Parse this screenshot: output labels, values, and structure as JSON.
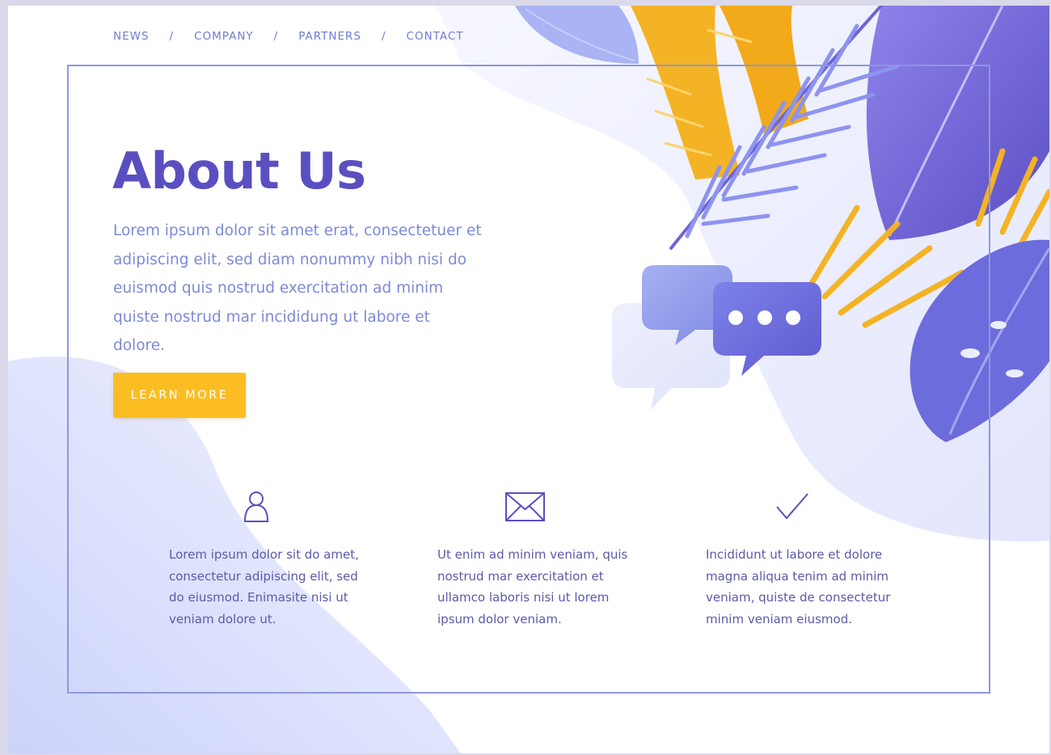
{
  "nav": {
    "items": [
      "NEWS",
      "COMPANY",
      "PARTNERS",
      "CONTACT"
    ],
    "separator": "/"
  },
  "hero": {
    "title": "About Us",
    "description": "Lorem ipsum dolor sit amet erat, consectetuer et adipiscing elit, sed diam nonummy nibh nisi do euismod quis nostrud exercitation ad minim quiste nostrud mar incididung ut labore et dolore.",
    "cta_label": "LEARN MORE"
  },
  "features": [
    {
      "icon": "user-icon",
      "text": "Lorem ipsum dolor sit do amet, consectetur adipiscing elit, sed do eiusmod. Enimasite nisi ut veniam dolore ut."
    },
    {
      "icon": "envelope-icon",
      "text": "Ut enim ad minim veniam, quis nostrud mar exercitation et ullamco laboris nisi ut lorem ipsum dolor veniam."
    },
    {
      "icon": "checkmark-icon",
      "text": "Incididunt ut labore et dolore magna aliqua tenim ad minim veniam, quiste de consectetur minim veniam eiusmod."
    }
  ],
  "colors": {
    "accent": "#5a4fc0",
    "link": "#6f7ccf",
    "button": "#fbbd22",
    "frame": "#8c98dc",
    "leaf_yellow": "#f4b324",
    "leaf_blue": "#7d86e6"
  }
}
